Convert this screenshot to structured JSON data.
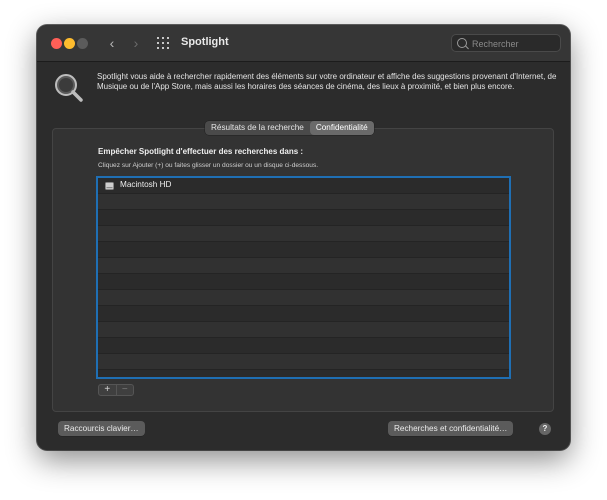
{
  "window": {
    "title": "Spotlight",
    "search_placeholder": "Rechercher",
    "nav_back": "‹",
    "nav_forward": "›"
  },
  "intro": {
    "description": "Spotlight vous aide à rechercher rapidement des éléments sur votre ordinateur et affiche des suggestions provenant d'Internet, de Musique ou de l'App Store, mais aussi les horaires des séances de cinéma, des lieux à proximité, et bien plus encore."
  },
  "tabs": [
    {
      "label": "Résultats de la recherche",
      "selected": false
    },
    {
      "label": "Confidentialité",
      "selected": true
    }
  ],
  "privacy": {
    "title": "Empêcher Spotlight d'effectuer des recherches dans :",
    "hint": "Cliquez sur Ajouter (+) ou faites glisser un dossier ou un disque ci-dessous.",
    "items": [
      "Macintosh HD"
    ],
    "add_label": "+",
    "remove_label": "−"
  },
  "footer": {
    "shortcuts_button": "Raccourcis clavier…",
    "privacy_button": "Recherches et confidentialité…",
    "help_label": "?"
  },
  "colors": {
    "accent": "#1f6fb4",
    "close": "#ff5f57",
    "minimize": "#febc2e"
  }
}
